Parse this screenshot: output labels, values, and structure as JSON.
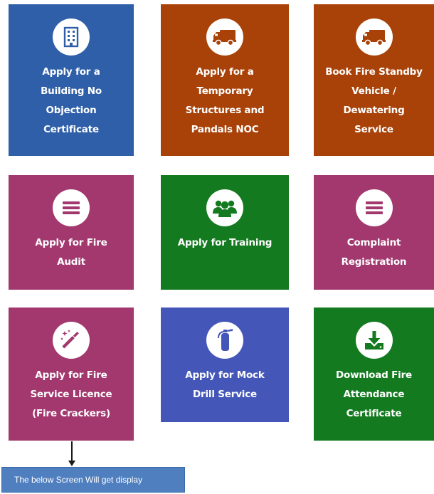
{
  "tiles": [
    {
      "label": "Apply for a Building No Objection Certificate",
      "lines": [
        "Apply for a",
        "Building No",
        "Objection",
        "Certificate"
      ],
      "icon": "building-icon",
      "color": "#2f5fa9"
    },
    {
      "label": "Apply for a Temporary Structures and Pandals NOC",
      "lines": [
        "Apply for a",
        "Temporary",
        "Structures and",
        "Pandals NOC"
      ],
      "icon": "truck-icon",
      "color": "#a94208"
    },
    {
      "label": "Book Fire Standby Vehicle / Dewatering Service",
      "lines": [
        "Book Fire Standby",
        "Vehicle /",
        "Dewatering",
        "Service"
      ],
      "icon": "truck-icon",
      "color": "#a94208"
    },
    {
      "label": "Apply for Fire Audit",
      "lines": [
        "Apply for Fire",
        "Audit"
      ],
      "icon": "menu-icon",
      "color": "#a2386e"
    },
    {
      "label": "Apply for Training",
      "lines": [
        "Apply for Training"
      ],
      "icon": "users-group-icon",
      "color": "#137a1f"
    },
    {
      "label": "Complaint Registration",
      "lines": [
        "Complaint",
        "Registration"
      ],
      "icon": "menu-icon",
      "color": "#a2386e"
    },
    {
      "label": "Apply for Fire Service Licence (Fire Crackers)",
      "lines": [
        "Apply for Fire",
        "Service Licence",
        "(Fire Crackers)"
      ],
      "icon": "magic-wand-icon",
      "color": "#a2386e"
    },
    {
      "label": "Apply for Mock Drill Service",
      "lines": [
        "Apply for Mock",
        "Drill Service"
      ],
      "icon": "fire-extinguisher-icon",
      "color": "#4457b8"
    },
    {
      "label": "Download Fire Attendance Certificate",
      "lines": [
        "Download Fire",
        "Attendance",
        "Certificate"
      ],
      "icon": "download-icon",
      "color": "#137a1f"
    }
  ],
  "note": {
    "text": "The below Screen Will get display",
    "color": "#4f7fbf"
  }
}
